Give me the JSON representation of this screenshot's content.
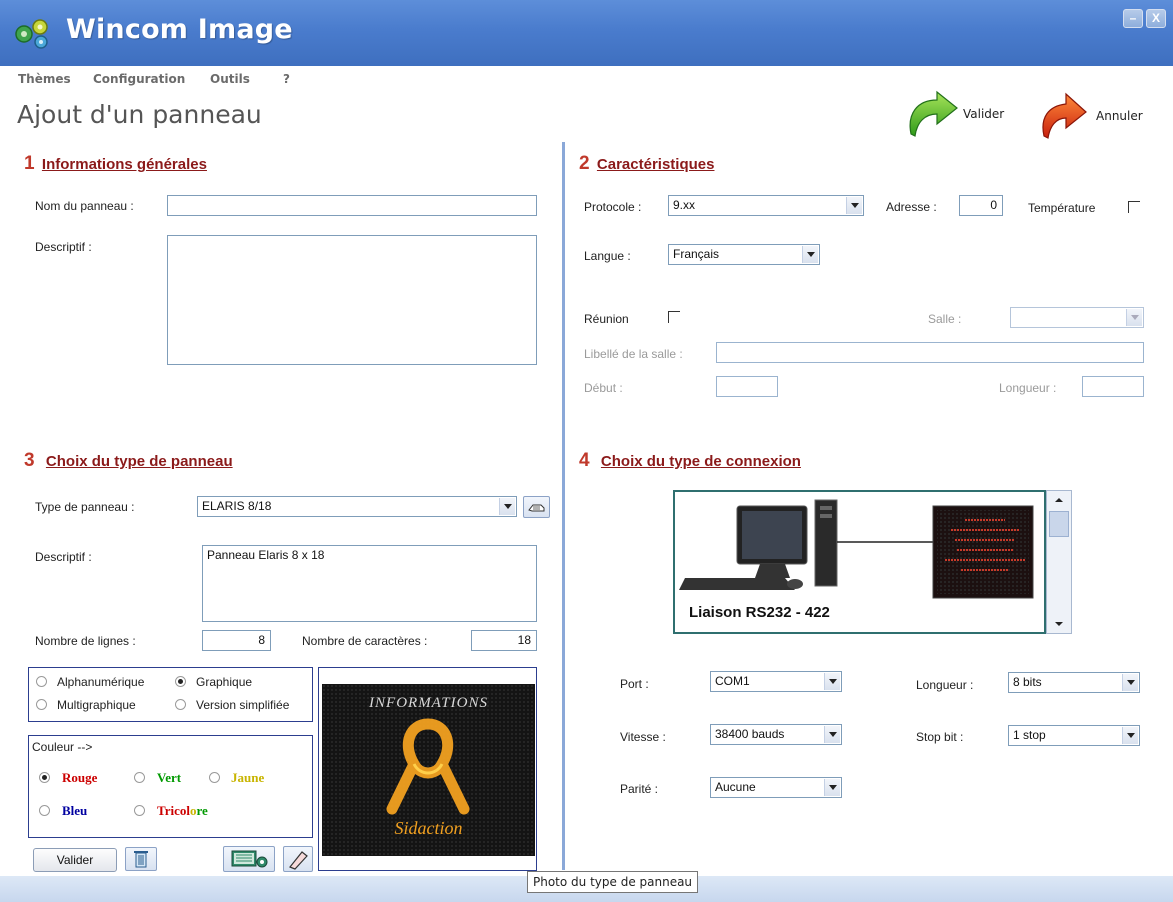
{
  "window": {
    "title": "Wincom Image",
    "minimize": "–",
    "close": "X"
  },
  "menu": [
    "Thèmes",
    "Configuration",
    "Outils",
    "?"
  ],
  "page": {
    "heading": "Ajout d'un panneau"
  },
  "toolbar": {
    "validate_label": "Valider",
    "cancel_label": "Annuler"
  },
  "section1": {
    "number": "1",
    "title": "Informations générales",
    "name_label": "Nom du panneau :",
    "name_value": "",
    "desc_label": "Descriptif :",
    "desc_value": ""
  },
  "section2": {
    "number": "2",
    "title": "Caractéristiques",
    "protocol_label": "Protocole :",
    "protocol_value": "9.xx",
    "address_label": "Adresse :",
    "address_value": "0",
    "temperature_label": "Température",
    "language_label": "Langue :",
    "language_value": "Français",
    "meeting_label": "Réunion",
    "room_label": "Salle :",
    "room_value": "",
    "room_name_label": "Libellé de la salle :",
    "room_name_value": "",
    "start_label": "Début :",
    "start_value": "",
    "length_label": "Longueur :",
    "length_value": ""
  },
  "section3": {
    "number": "3",
    "title": "Choix du type de panneau",
    "type_label": "Type de panneau :",
    "type_value": "ELARIS 8/18",
    "desc_label": "Descriptif :",
    "desc_value": "Panneau Elaris 8 x 18",
    "lines_label": "Nombre de lignes :",
    "lines_value": "8",
    "chars_label": "Nombre de caractères :",
    "chars_value": "18",
    "modes": [
      {
        "label": "Alphanumérique",
        "selected": false
      },
      {
        "label": "Graphique",
        "selected": true
      },
      {
        "label": "Multigraphique",
        "selected": false
      },
      {
        "label": "Version simplifiée",
        "selected": false
      }
    ],
    "color_group_label": "Couleur -->",
    "colors": [
      {
        "label": "Rouge",
        "color": "#cc0000",
        "selected": true
      },
      {
        "label": "Vert",
        "color": "#009900",
        "selected": false
      },
      {
        "label": "Jaune",
        "color": "#c8b400",
        "selected": false
      },
      {
        "label": "Bleu",
        "color": "#0000a0",
        "selected": false
      },
      {
        "label": "Tricolore",
        "color": "#cc0000",
        "selected": false
      }
    ],
    "tricolore_parts": [
      "Tricol",
      "o",
      "re"
    ],
    "validate_button": "Valider",
    "preview_banner": "INFORMATIONS",
    "preview_caption": "Sidaction"
  },
  "section4": {
    "number": "4",
    "title": "Choix du type de connexion",
    "connection_caption": "Liaison RS232 - 422",
    "port_label": "Port :",
    "port_value": "COM1",
    "length_label": "Longueur :",
    "length_value": "8 bits",
    "speed_label": "Vitesse :",
    "speed_value": "38400 bauds",
    "stopbit_label": "Stop bit :",
    "stopbit_value": "1 stop",
    "parity_label": "Parité :",
    "parity_value": "Aucune"
  },
  "tooltip": "Photo du type de panneau",
  "colors": {
    "titlebar": "#4a7ccd",
    "section_title": "#8b1a1a",
    "section_number": "#c0392b",
    "divider": "#8aa8d8"
  }
}
